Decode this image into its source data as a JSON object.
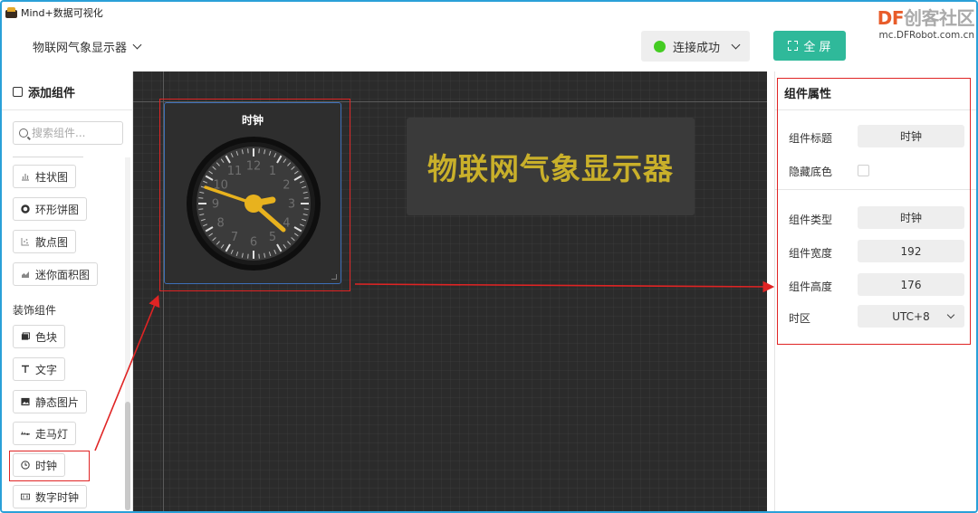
{
  "window": {
    "title": "Mind+数据可视化"
  },
  "watermark": {
    "brand_df": "DF",
    "brand_cn": "创客社区",
    "url": "mc.DFRobot.com.cn"
  },
  "header": {
    "project_name": "物联网气象显示器",
    "connection_status": "连接成功",
    "status_color": "#44cc22",
    "fullscreen_label": "全 屏",
    "accent_color": "#2fb99a"
  },
  "sidebar": {
    "title": "添加组件",
    "search_placeholder": "搜索组件...",
    "chart_items": [
      {
        "label": "柱状图",
        "icon": "bar-chart-icon"
      },
      {
        "label": "环形饼图",
        "icon": "donut-chart-icon"
      },
      {
        "label": "散点图",
        "icon": "scatter-chart-icon"
      },
      {
        "label": "迷你面积图",
        "icon": "area-chart-icon"
      }
    ],
    "decor_section": "装饰组件",
    "decor_items": [
      {
        "label": "色块",
        "icon": "color-block-icon"
      },
      {
        "label": "文字",
        "icon": "text-icon"
      },
      {
        "label": "静态图片",
        "icon": "image-icon"
      },
      {
        "label": "走马灯",
        "icon": "marquee-icon"
      },
      {
        "label": "时钟",
        "icon": "clock-icon"
      },
      {
        "label": "数字时钟",
        "icon": "digital-clock-icon"
      }
    ]
  },
  "canvas": {
    "clock_widget": {
      "title": "时钟",
      "hour_numbers": [
        "12",
        "1",
        "2",
        "3",
        "4",
        "5",
        "6",
        "7",
        "8",
        "9",
        "10",
        "11"
      ],
      "hand_color": "#e8b21e"
    },
    "title_widget": {
      "text": "物联网气象显示器",
      "color": "#c9b02a"
    }
  },
  "properties": {
    "title": "组件属性",
    "fields": {
      "widget_title_label": "组件标题",
      "widget_title_value": "时钟",
      "hide_bg_label": "隐藏底色",
      "type_label": "组件类型",
      "type_value": "时钟",
      "width_label": "组件宽度",
      "width_value": "192",
      "height_label": "组件高度",
      "height_value": "176",
      "timezone_label": "时区",
      "timezone_value": "UTC+8"
    }
  },
  "annotation_color": "#e02424"
}
